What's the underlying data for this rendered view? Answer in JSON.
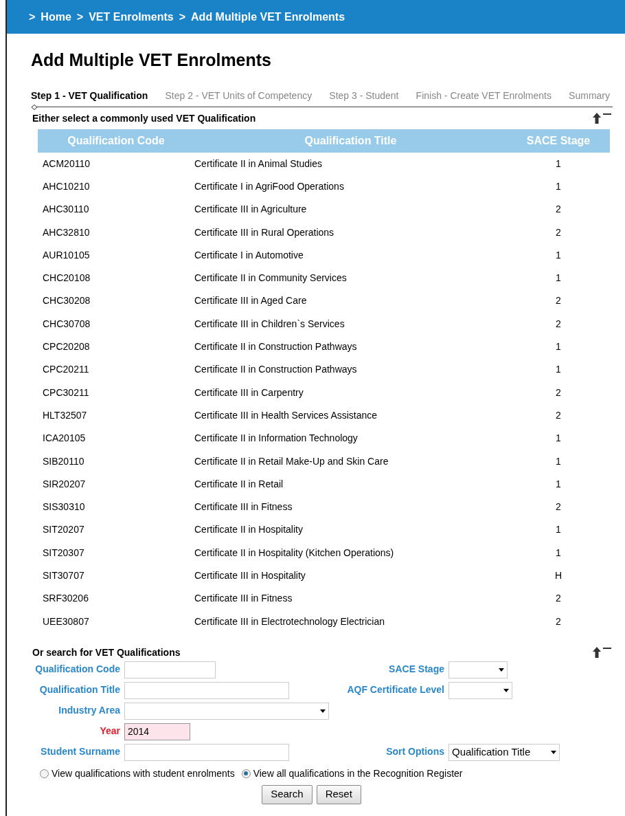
{
  "breadcrumb": [
    ">",
    "Home",
    ">",
    "VET Enrolments",
    ">",
    "Add Multiple VET Enrolments"
  ],
  "title": "Add Multiple VET Enrolments",
  "steps": [
    {
      "label": "Step 1 - VET Qualification",
      "selected": true
    },
    {
      "label": "Step 2 - VET Units of Competency",
      "selected": false
    },
    {
      "label": "Step 3 - Student",
      "selected": false
    },
    {
      "label": "Finish - Create VET Enrolments",
      "selected": false
    },
    {
      "label": "Summary",
      "selected": false
    }
  ],
  "common": {
    "heading": "Either select a commonly used VET Qualification",
    "columns": [
      "Qualification Code",
      "Qualification Title",
      "SACE Stage"
    ],
    "rows": [
      [
        "ACM20110",
        "Certificate II in Animal Studies",
        "1"
      ],
      [
        "AHC10210",
        "Certificate I in AgriFood Operations",
        "1"
      ],
      [
        "AHC30110",
        "Certificate III in Agriculture",
        "2"
      ],
      [
        "AHC32810",
        "Certificate III in Rural Operations",
        "2"
      ],
      [
        "AUR10105",
        "Certificate I in Automotive",
        "1"
      ],
      [
        "CHC20108",
        "Certificate II in Community Services",
        "1"
      ],
      [
        "CHC30208",
        "Certificate III in Aged Care",
        "2"
      ],
      [
        "CHC30708",
        "Certificate III in Children`s Services",
        "2"
      ],
      [
        "CPC20208",
        "Certificate II in Construction Pathways",
        "1"
      ],
      [
        "CPC20211",
        "Certificate II in Construction Pathways",
        "1"
      ],
      [
        "CPC30211",
        "Certificate III in Carpentry",
        "2"
      ],
      [
        "HLT32507",
        "Certificate III in Health Services Assistance",
        "2"
      ],
      [
        "ICA20105",
        "Certificate II in Information Technology",
        "1"
      ],
      [
        "SIB20110",
        "Certificate II in Retail Make-Up and Skin Care",
        "1"
      ],
      [
        "SIR20207",
        "Certificate II in Retail",
        "1"
      ],
      [
        "SIS30310",
        "Certificate III in Fitness",
        "2"
      ],
      [
        "SIT20207",
        "Certificate II in Hospitality",
        "1"
      ],
      [
        "SIT20307",
        "Certificate II in Hospitality (Kitchen Operations)",
        "1"
      ],
      [
        "SIT30707",
        "Certificate III in Hospitality",
        "H"
      ],
      [
        "SRF30206",
        "Certificate III in Fitness",
        "2"
      ],
      [
        "UEE30807",
        "Certificate III in Electrotechnology Electrician",
        "2"
      ]
    ]
  },
  "search": {
    "heading": "Or search for VET Qualifications",
    "rows": [
      {
        "left": {
          "label": "Qualification Code",
          "kind": "text",
          "required": false
        },
        "right": {
          "label": "SACE Stage",
          "kind": "select",
          "required": false
        }
      },
      {
        "left": {
          "label": "Qualification Title",
          "kind": "text",
          "required": false
        },
        "right": {
          "label": "AQF Certificate Level",
          "kind": "select",
          "required": false
        }
      },
      {
        "left": {
          "label": "Industry Area",
          "kind": "select",
          "required": false
        }
      },
      {
        "left": {
          "label": "Year",
          "kind": "text",
          "value": "2014",
          "required": true
        }
      },
      {
        "left": {
          "label": "Student Surname",
          "kind": "text",
          "required": false
        },
        "right": {
          "label": "Sort Options",
          "kind": "select",
          "value": "Qualification Title",
          "required": false
        }
      }
    ],
    "options": [
      {
        "label": "View qualifications with student enrolments",
        "selected": false
      },
      {
        "label": "View all qualifications in the Recognition Register",
        "selected": true
      }
    ],
    "buttons": [
      "Search",
      "Reset"
    ]
  }
}
